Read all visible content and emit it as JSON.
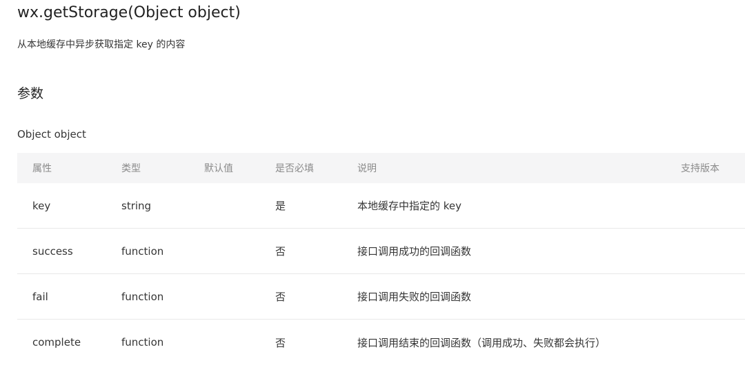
{
  "doc": {
    "title": "wx.getStorage(Object object)",
    "description": "从本地缓存中异步获取指定 key 的内容",
    "section_heading": "参数",
    "subsection_heading": "Object object"
  },
  "table": {
    "headers": {
      "name": "属性",
      "type": "类型",
      "default": "默认值",
      "required": "是否必填",
      "description": "说明",
      "version": "支持版本"
    },
    "rows": [
      {
        "name": "key",
        "type": "string",
        "default": "",
        "required": "是",
        "description": "本地缓存中指定的 key",
        "version": ""
      },
      {
        "name": "success",
        "type": "function",
        "default": "",
        "required": "否",
        "description": "接口调用成功的回调函数",
        "version": ""
      },
      {
        "name": "fail",
        "type": "function",
        "default": "",
        "required": "否",
        "description": "接口调用失败的回调函数",
        "version": ""
      },
      {
        "name": "complete",
        "type": "function",
        "default": "",
        "required": "否",
        "description": "接口调用结束的回调函数（调用成功、失败都会执行）",
        "version": ""
      }
    ]
  }
}
